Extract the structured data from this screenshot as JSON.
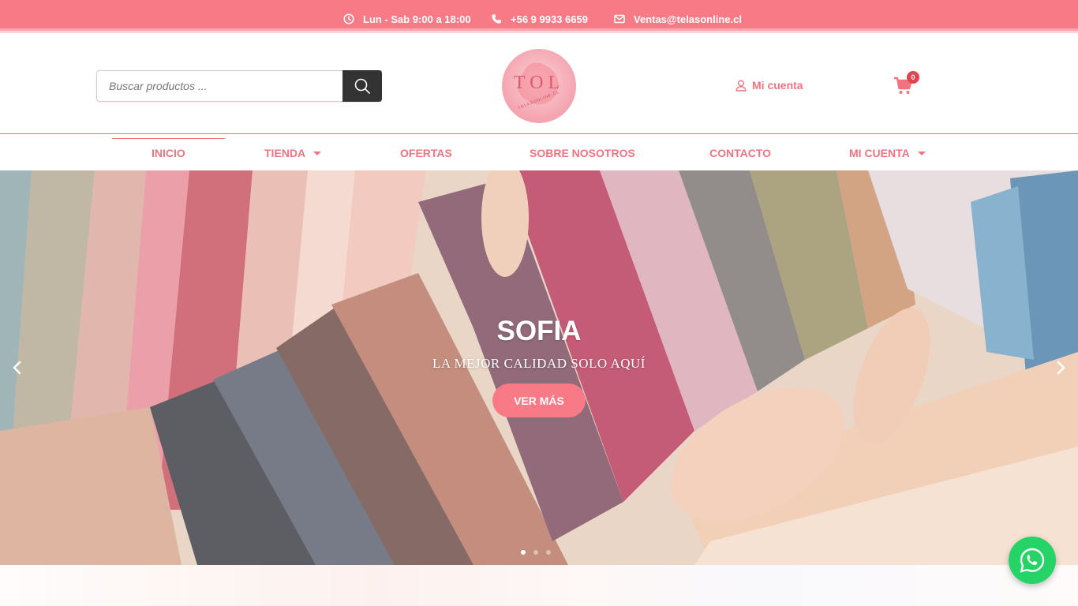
{
  "topbar": {
    "hours": "Lun - Sab 9:00 a 18:00",
    "phone": "+56 9 9933 6659",
    "email": "Ventas@telasonline.cl"
  },
  "header": {
    "search_placeholder": "Buscar productos ...",
    "logo_text": "TOL",
    "logo_subtext": "TELASONLINE.CL",
    "account_label": "Mi cuenta",
    "cart_count": "0"
  },
  "nav": {
    "items": [
      {
        "label": "INICIO",
        "active": true,
        "dropdown": false
      },
      {
        "label": "TIENDA",
        "active": false,
        "dropdown": true
      },
      {
        "label": "OFERTAS",
        "active": false,
        "dropdown": false
      },
      {
        "label": "SOBRE NOSOTROS",
        "active": false,
        "dropdown": false
      },
      {
        "label": "CONTACTO",
        "active": false,
        "dropdown": false
      },
      {
        "label": "MI CUENTA",
        "active": false,
        "dropdown": true
      }
    ]
  },
  "hero": {
    "title": "SOFIA",
    "subtitle": "LA MEJOR CALIDAD SOLO AQUÍ",
    "button_label": "VER MÁS",
    "slide_count": 3,
    "active_slide": 1
  },
  "colors": {
    "accent": "#f87a86",
    "nav_text": "#f17380",
    "search_button": "#333333",
    "whatsapp": "#25d366"
  },
  "icons": [
    "clock-icon",
    "phone-icon",
    "mail-icon",
    "search-icon",
    "user-icon",
    "cart-icon",
    "chevron-left-icon",
    "chevron-right-icon",
    "whatsapp-icon"
  ]
}
